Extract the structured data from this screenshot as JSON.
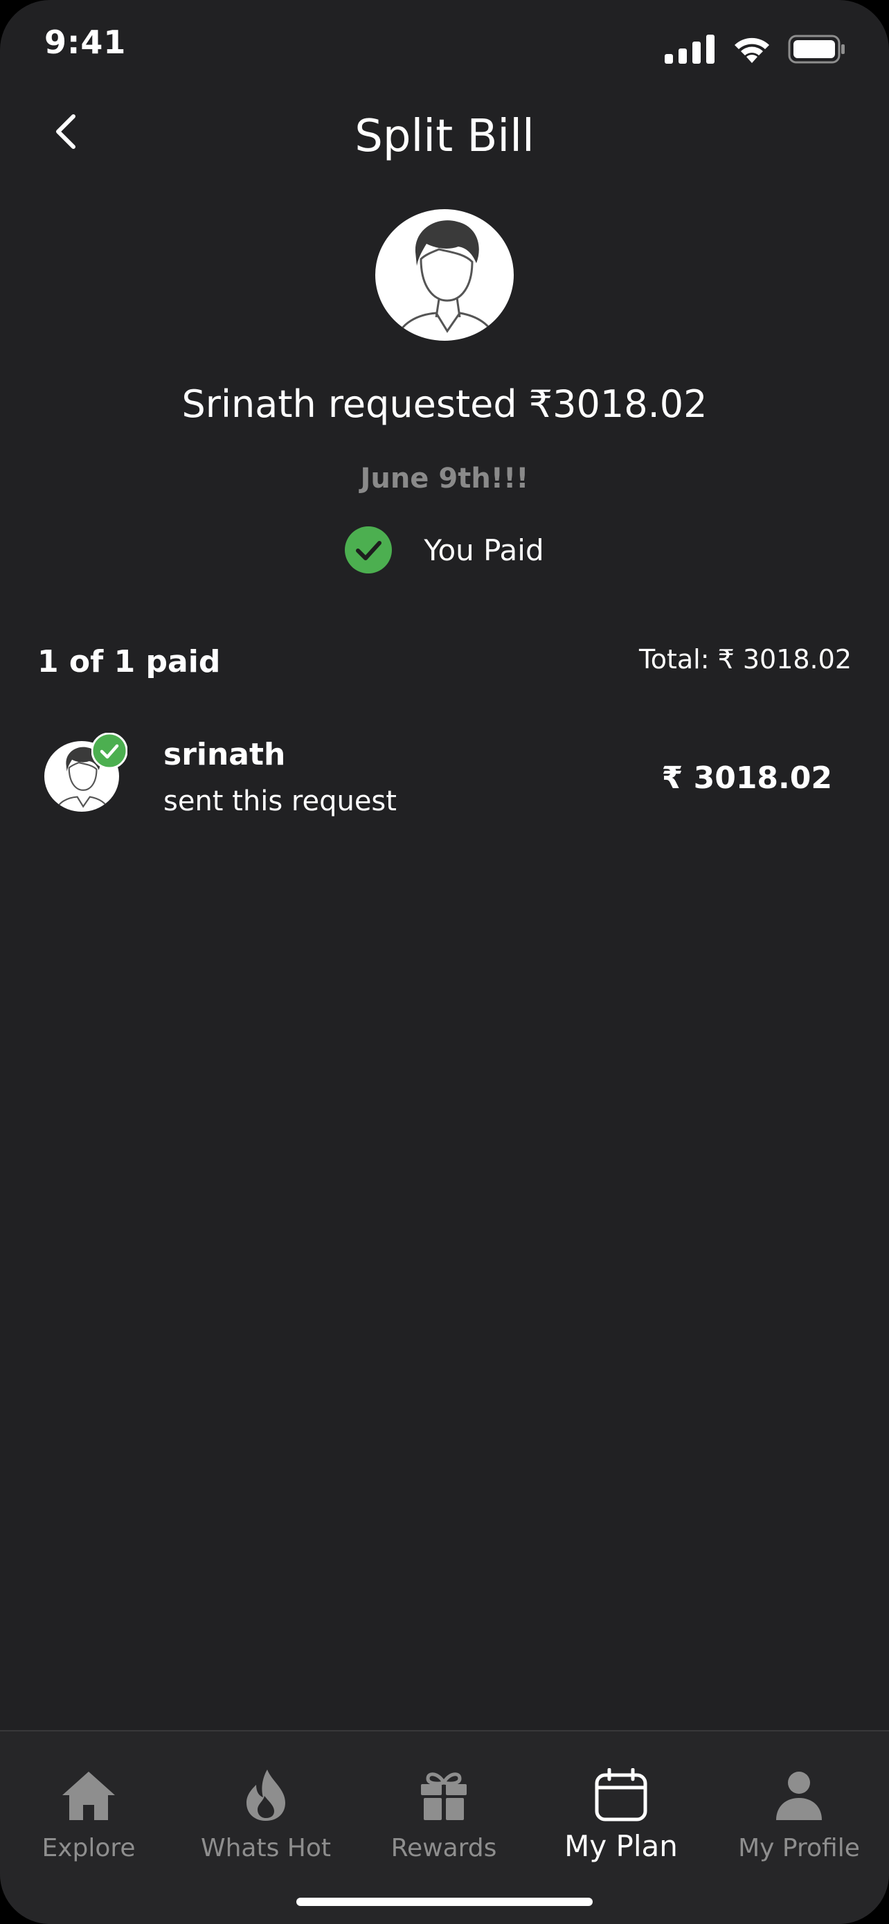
{
  "status_bar": {
    "time": "9:41"
  },
  "header": {
    "title": "Split Bill",
    "back_icon": "chevron-left-icon"
  },
  "request": {
    "text": "Srinath requested ₹3018.02",
    "note": "June 9th!!!",
    "paid_label": "You Paid",
    "paid_icon": "check-circle-icon"
  },
  "summary": {
    "paid_count": "1 of 1 paid",
    "total": "Total: ₹ 3018.02"
  },
  "participants": [
    {
      "name": "srinath",
      "subtitle": "sent this request",
      "amount": "₹ 3018.02",
      "status_icon": "check-circle-icon"
    }
  ],
  "bottom_nav": {
    "items": [
      {
        "label": "Explore",
        "icon": "home-icon"
      },
      {
        "label": "Whats Hot",
        "icon": "flame-icon"
      },
      {
        "label": "Rewards",
        "icon": "gift-icon"
      },
      {
        "label": "My Plan",
        "icon": "calendar-icon",
        "active": true
      },
      {
        "label": "My Profile",
        "icon": "person-icon"
      }
    ]
  },
  "colors": {
    "background": "#212123",
    "accent_green": "#4CAF50",
    "muted_text": "#8a8a8a",
    "nav_background": "#262628"
  }
}
